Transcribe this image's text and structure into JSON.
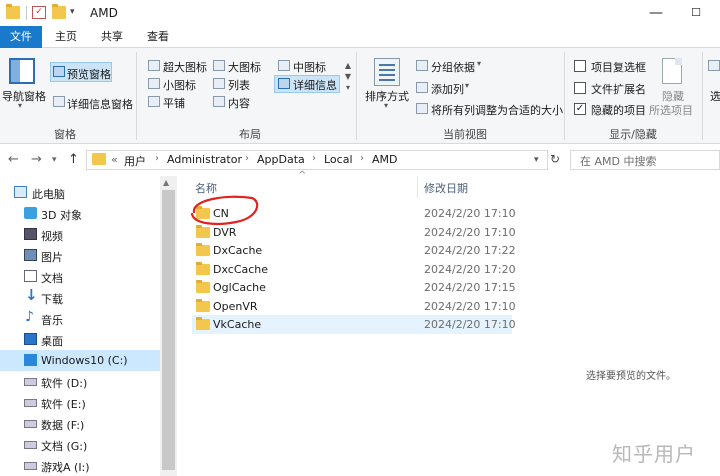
{
  "window": {
    "title": "AMD",
    "controls": {
      "minimize": "—",
      "maximize": "☐"
    }
  },
  "tabs": [
    "文件",
    "主页",
    "共享",
    "查看"
  ],
  "ribbon": {
    "groups": {
      "panes": {
        "label": "窗格",
        "nav_pane": "导航窗格",
        "preview_pane": "预览窗格",
        "details_pane": "详细信息窗格"
      },
      "layout": {
        "label": "布局",
        "items": [
          "超大图标",
          "大图标",
          "中图标",
          "小图标",
          "列表",
          "详细信息",
          "平铺",
          "内容"
        ]
      },
      "current_view": {
        "label": "当前视图",
        "sort_by": "排序方式",
        "group_by": "分组依据",
        "add_column": "添加列",
        "fit_columns": "将所有列调整为合适的大小"
      },
      "show_hide": {
        "label": "显示/隐藏",
        "item_checkboxes": {
          "text": "项目复选框",
          "checked": false
        },
        "file_extensions": {
          "text": "文件扩展名",
          "checked": false
        },
        "hidden_items": {
          "text": "隐藏的项目",
          "checked": true
        },
        "hide_selected_1": "隐藏",
        "hide_selected_2": "所选项目",
        "options_partial": "选"
      }
    }
  },
  "address": {
    "prefix": "«",
    "crumbs": [
      "用户",
      "Administrator",
      "AppData",
      "Local",
      "AMD"
    ],
    "search_placeholder": "在 AMD 中搜索"
  },
  "nav_items": [
    {
      "label": "此电脑",
      "icon": "computer-icon"
    },
    {
      "label": "3D 对象",
      "icon": "3d-objects-icon"
    },
    {
      "label": "视频",
      "icon": "video-icon"
    },
    {
      "label": "图片",
      "icon": "pictures-icon"
    },
    {
      "label": "文档",
      "icon": "documents-icon"
    },
    {
      "label": "下载",
      "icon": "download-icon"
    },
    {
      "label": "音乐",
      "icon": "music-icon"
    },
    {
      "label": "桌面",
      "icon": "desktop-icon"
    },
    {
      "label": "Windows10 (C:)",
      "icon": "windows-drive-icon"
    },
    {
      "label": "软件 (D:)",
      "icon": "drive-icon"
    },
    {
      "label": "软件 (E:)",
      "icon": "drive-icon"
    },
    {
      "label": "数据 (F:)",
      "icon": "drive-icon"
    },
    {
      "label": "文档 (G:)",
      "icon": "drive-icon"
    },
    {
      "label": "游戏A (I:)",
      "icon": "drive-icon"
    }
  ],
  "columns": {
    "name": "名称",
    "date": "修改日期"
  },
  "files": [
    {
      "name": "CN",
      "date": "2024/2/20 17:10"
    },
    {
      "name": "DVR",
      "date": "2024/2/20 17:10"
    },
    {
      "name": "DxCache",
      "date": "2024/2/20 17:22"
    },
    {
      "name": "DxcCache",
      "date": "2024/2/20 17:20"
    },
    {
      "name": "OglCache",
      "date": "2024/2/20 17:15"
    },
    {
      "name": "OpenVR",
      "date": "2024/2/20 17:10"
    },
    {
      "name": "VkCache",
      "date": "2024/2/20 17:10"
    }
  ],
  "preview_message": "选择要预览的文件。",
  "watermark": "知乎用户"
}
